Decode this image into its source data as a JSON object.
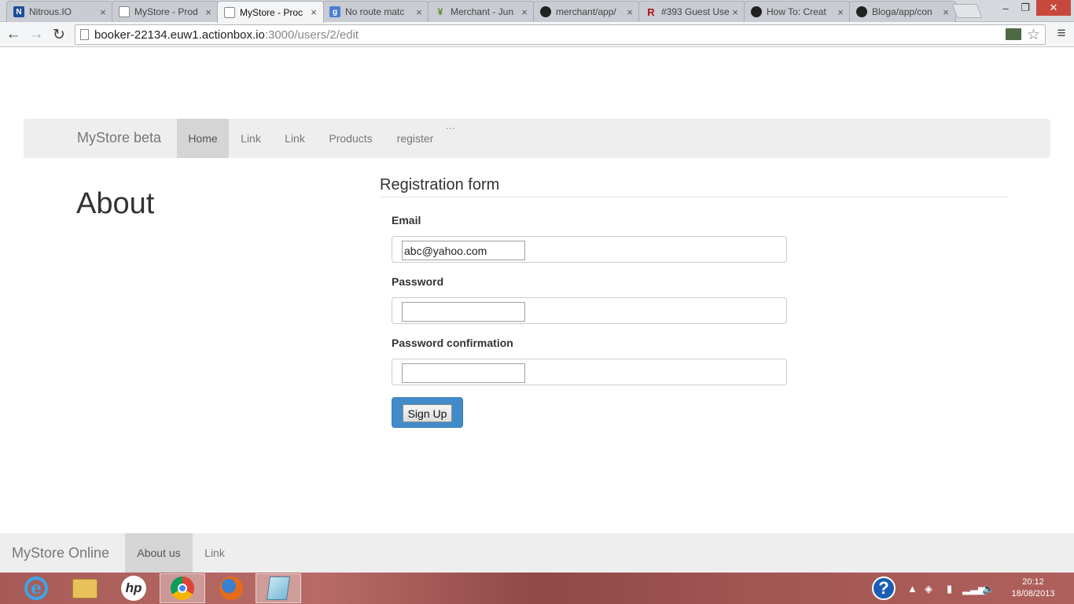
{
  "browser": {
    "tabs": [
      {
        "title": "Nitrous.IO",
        "icon": "nitrous-icon"
      },
      {
        "title": "MyStore - Prod",
        "icon": "page-icon"
      },
      {
        "title": "MyStore - Proc",
        "icon": "page-icon",
        "active": true
      },
      {
        "title": "No route matc",
        "icon": "google-icon"
      },
      {
        "title": "Merchant - Jun",
        "icon": "merchant-icon"
      },
      {
        "title": "merchant/app/",
        "icon": "github-icon"
      },
      {
        "title": "#393 Guest Use",
        "icon": "railscasts-icon"
      },
      {
        "title": "How To: Creat",
        "icon": "github-icon"
      },
      {
        "title": "Bloga/app/con",
        "icon": "github-icon"
      }
    ],
    "url_host": "booker-22134.euw1.actionbox.io",
    "url_rest": ":3000/users/2/edit"
  },
  "navbar": {
    "brand": "MyStore beta",
    "items": [
      {
        "label": "Home",
        "active": true
      },
      {
        "label": "Link"
      },
      {
        "label": "Link"
      },
      {
        "label": "Products"
      },
      {
        "label": "register"
      }
    ],
    "more": "..."
  },
  "about": {
    "heading": "About"
  },
  "form": {
    "legend": "Registration form",
    "email_label": "Email",
    "email_value": "abc@yahoo.com",
    "password_label": "Password",
    "password_value": "",
    "confirmation_label": "Password confirmation",
    "confirmation_value": "",
    "submit_label": "Sign Up"
  },
  "footer": {
    "brand": "MyStore Online",
    "items": [
      {
        "label": "About us",
        "active": true
      },
      {
        "label": "Link"
      }
    ]
  },
  "taskbar": {
    "apps": [
      "internet-explorer-icon",
      "file-explorer-icon",
      "hp-icon",
      "chrome-icon",
      "firefox-icon",
      "notepad-icon"
    ],
    "time": "20:12",
    "date": "18/08/2013"
  },
  "colors": {
    "primary_button": "#428bca",
    "navbar_bg": "#eeeeee",
    "navbar_active": "#d5d5d5"
  }
}
